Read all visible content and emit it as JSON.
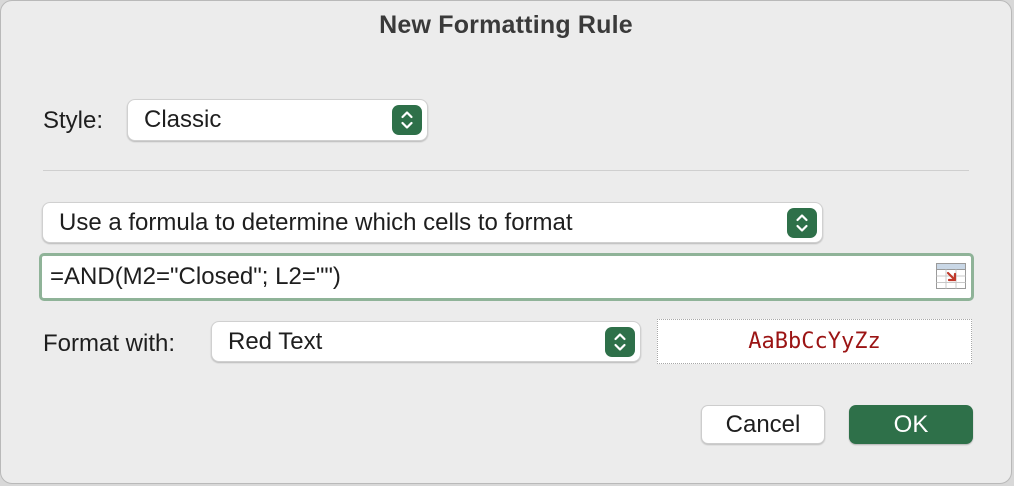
{
  "dialog": {
    "title": "New Formatting Rule"
  },
  "style": {
    "label": "Style:",
    "selected": "Classic"
  },
  "rule_type": {
    "selected": "Use a formula to determine which cells to format"
  },
  "formula": {
    "value": "=AND(M2=\"Closed\"; L2=\"\")"
  },
  "format_with": {
    "label": "Format with:",
    "selected": "Red Text",
    "preview": "AaBbCcYyZz"
  },
  "buttons": {
    "cancel": "Cancel",
    "ok": "OK"
  },
  "colors": {
    "accent": "#2e7049",
    "preview_text": "#9b1414",
    "focus_ring": "#8fb398"
  }
}
